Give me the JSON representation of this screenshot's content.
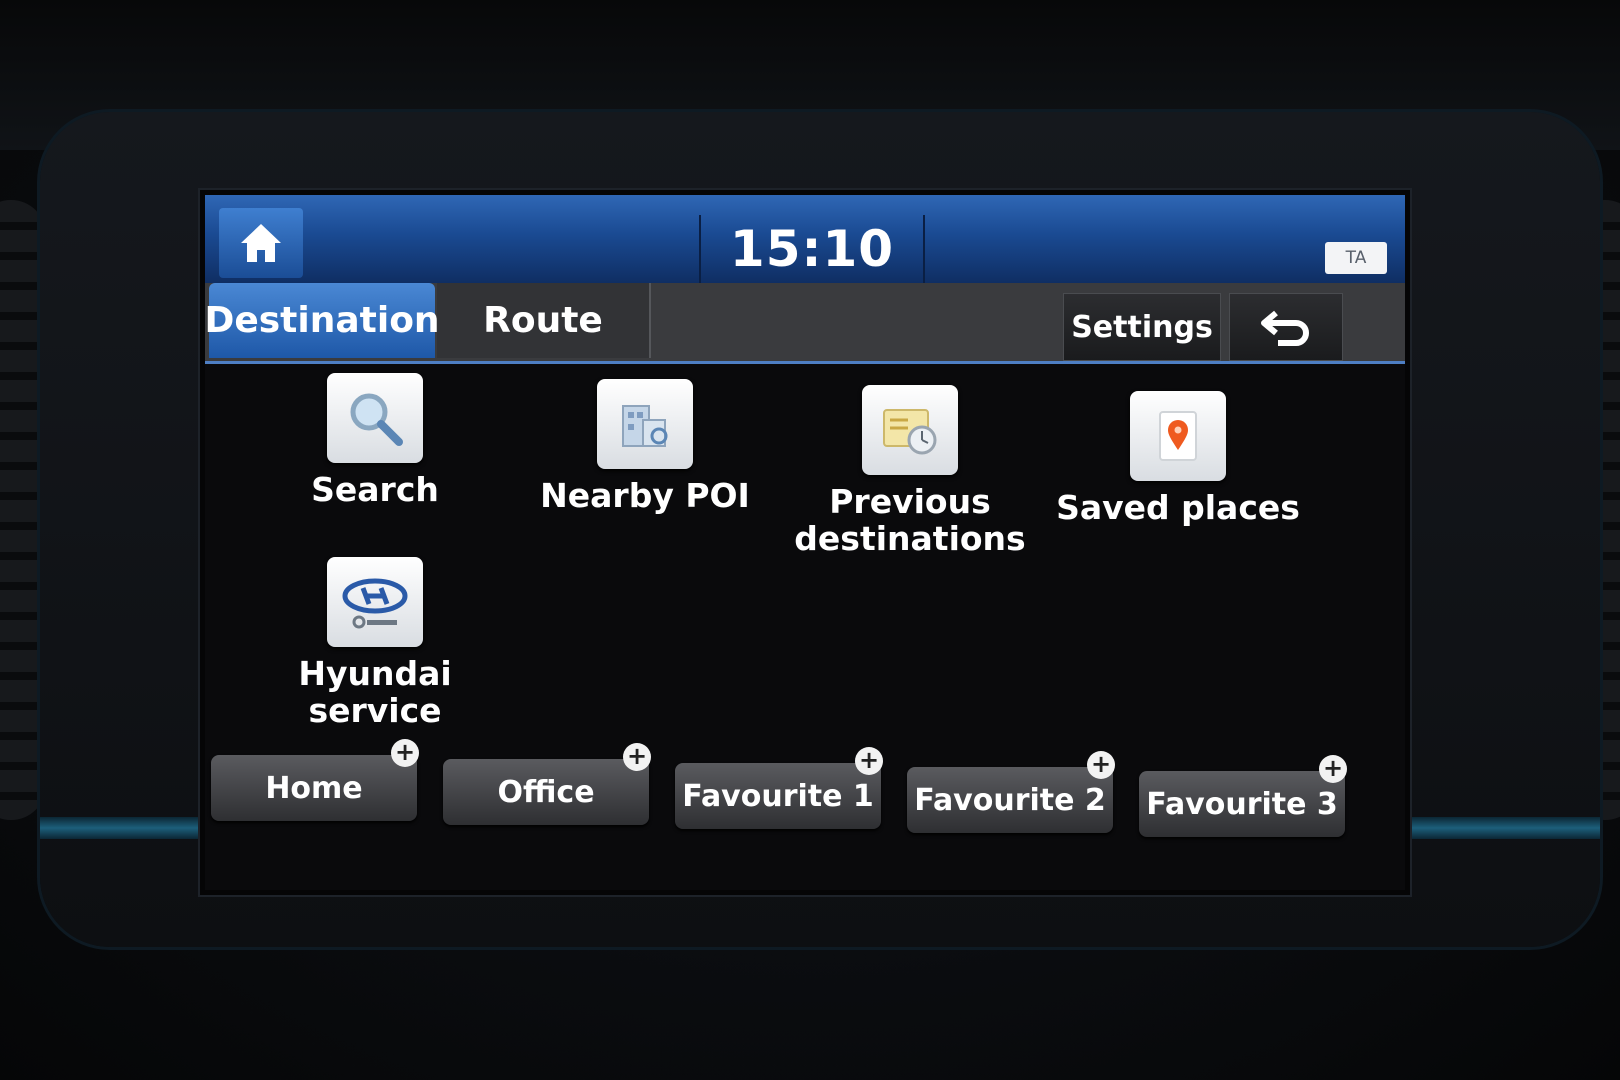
{
  "statusbar": {
    "home_icon": "home-icon",
    "time": "15:10",
    "ta_label": "TA"
  },
  "tabs": {
    "destination": "Destination",
    "route": "Route",
    "settings": "Settings",
    "back_icon": "back-arrow-icon",
    "active_color": "#2f6fc2"
  },
  "menu": [
    {
      "label": "Search",
      "icon": "search-magnifier-icon"
    },
    {
      "label": "Nearby POI",
      "icon": "building-poi-icon"
    },
    {
      "label": "Previous destinations",
      "line1": "Previous",
      "line2": "destinations",
      "icon": "history-clock-icon"
    },
    {
      "label": "Saved places",
      "icon": "map-pin-icon"
    },
    {
      "label": "Hyundai service",
      "line1": "Hyundai",
      "line2": "service",
      "icon": "hyundai-service-icon"
    }
  ],
  "favourites": [
    {
      "label": "Home",
      "plus": "+"
    },
    {
      "label": "Office",
      "plus": "+"
    },
    {
      "label": "Favourite 1",
      "plus": "+"
    },
    {
      "label": "Favourite 2",
      "plus": "+"
    },
    {
      "label": "Favourite 3",
      "plus": "+"
    }
  ]
}
